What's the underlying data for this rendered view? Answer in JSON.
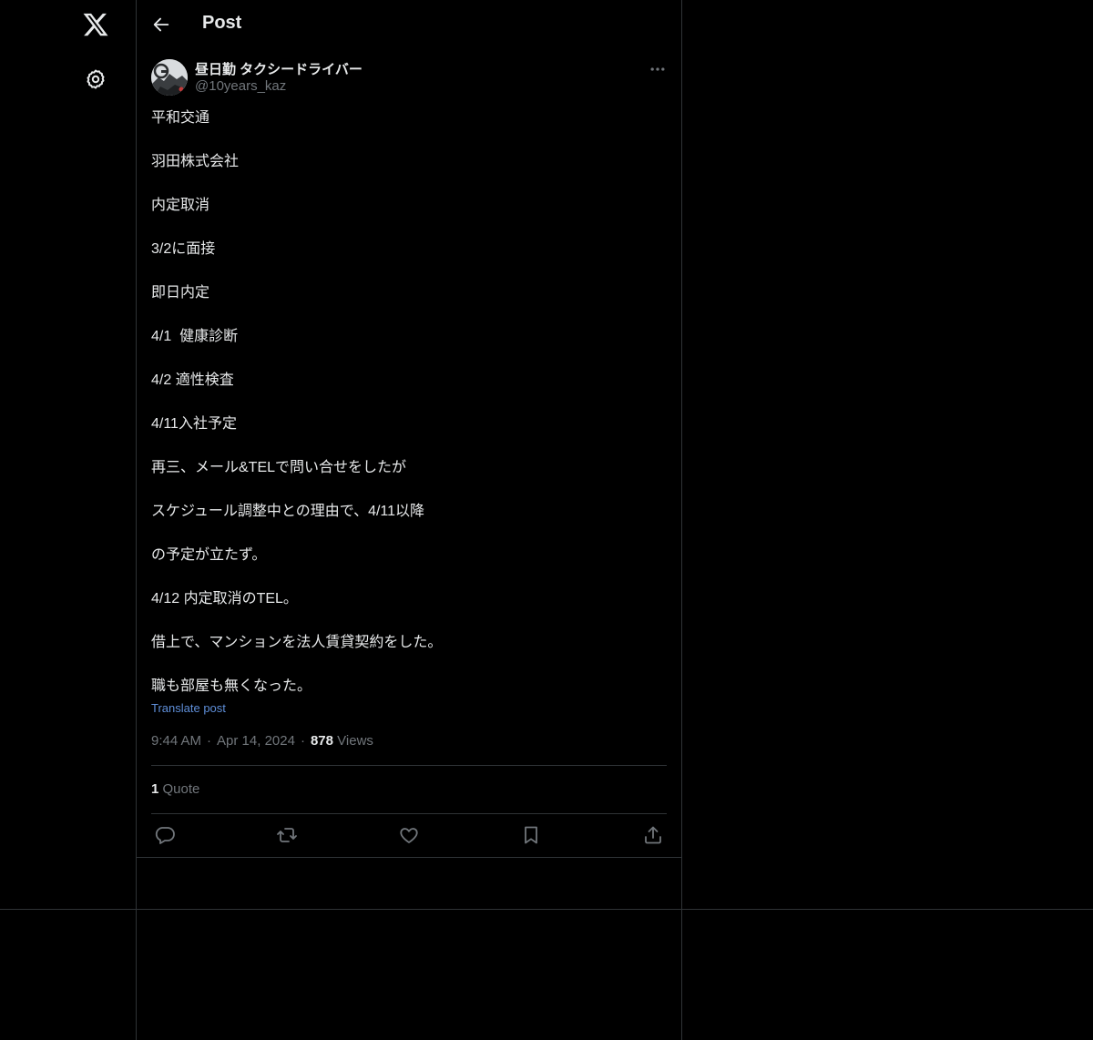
{
  "header": {
    "title": "Post"
  },
  "nav": {
    "logo_icon": "x-logo-icon",
    "settings_icon": "gear-icon"
  },
  "author": {
    "name": "昼日勤 タクシードライバー",
    "handle": "@10years_kaz"
  },
  "post": {
    "lines": [
      "平和交通",
      "羽田株式会社",
      "内定取消",
      "3/2に面接",
      "即日内定",
      "4/1  健康診断",
      "4/2 適性検査",
      "4/11入社予定",
      "再三、メール&TELで問い合せをしたが",
      "スケジュール調整中との理由で、4/11以降",
      "の予定が立たず。",
      "4/12 内定取消のTEL。",
      "借上で、マンションを法人賃貸契約をした。",
      "職も部屋も無くなった。"
    ],
    "translate_label": "Translate post",
    "time": "9:44 AM",
    "date": "Apr 14, 2024",
    "views_count": "878",
    "views_label": "Views",
    "separator": "·"
  },
  "stats": {
    "quotes_count": "1",
    "quotes_label": "Quote"
  },
  "actions": [
    "reply-icon",
    "repost-icon",
    "like-icon",
    "bookmark-icon",
    "share-icon"
  ],
  "colors": {
    "background": "#000000",
    "text": "#e7e9ea",
    "muted": "#71767b",
    "link": "#5f8fd9",
    "border": "#2f3336"
  }
}
